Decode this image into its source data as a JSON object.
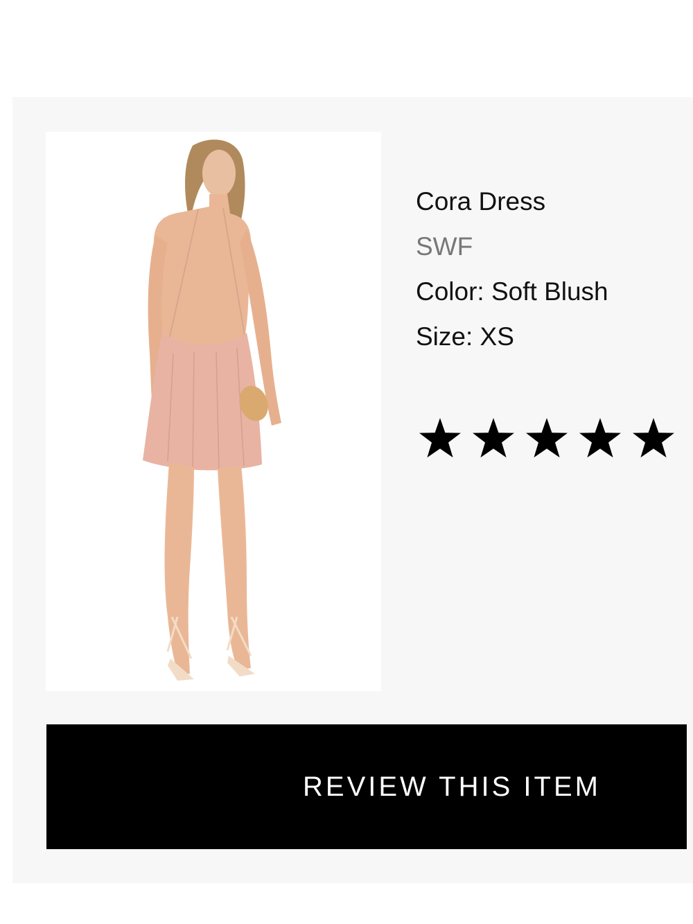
{
  "product": {
    "name": "Cora Dress",
    "brand": "SWF",
    "color_line": "Color: Soft Blush",
    "size_line": "Size: XS",
    "image_icon": "product-photo",
    "rating": {
      "value": 5,
      "max": 5,
      "icon": "star-icon",
      "color": "#000000"
    }
  },
  "actions": {
    "review_label": "REVIEW THIS ITEM"
  },
  "colors": {
    "card_background": "#f7f7f7",
    "button_background": "#000000",
    "brand_text": "#777777",
    "dress": "#e8b3a3"
  }
}
